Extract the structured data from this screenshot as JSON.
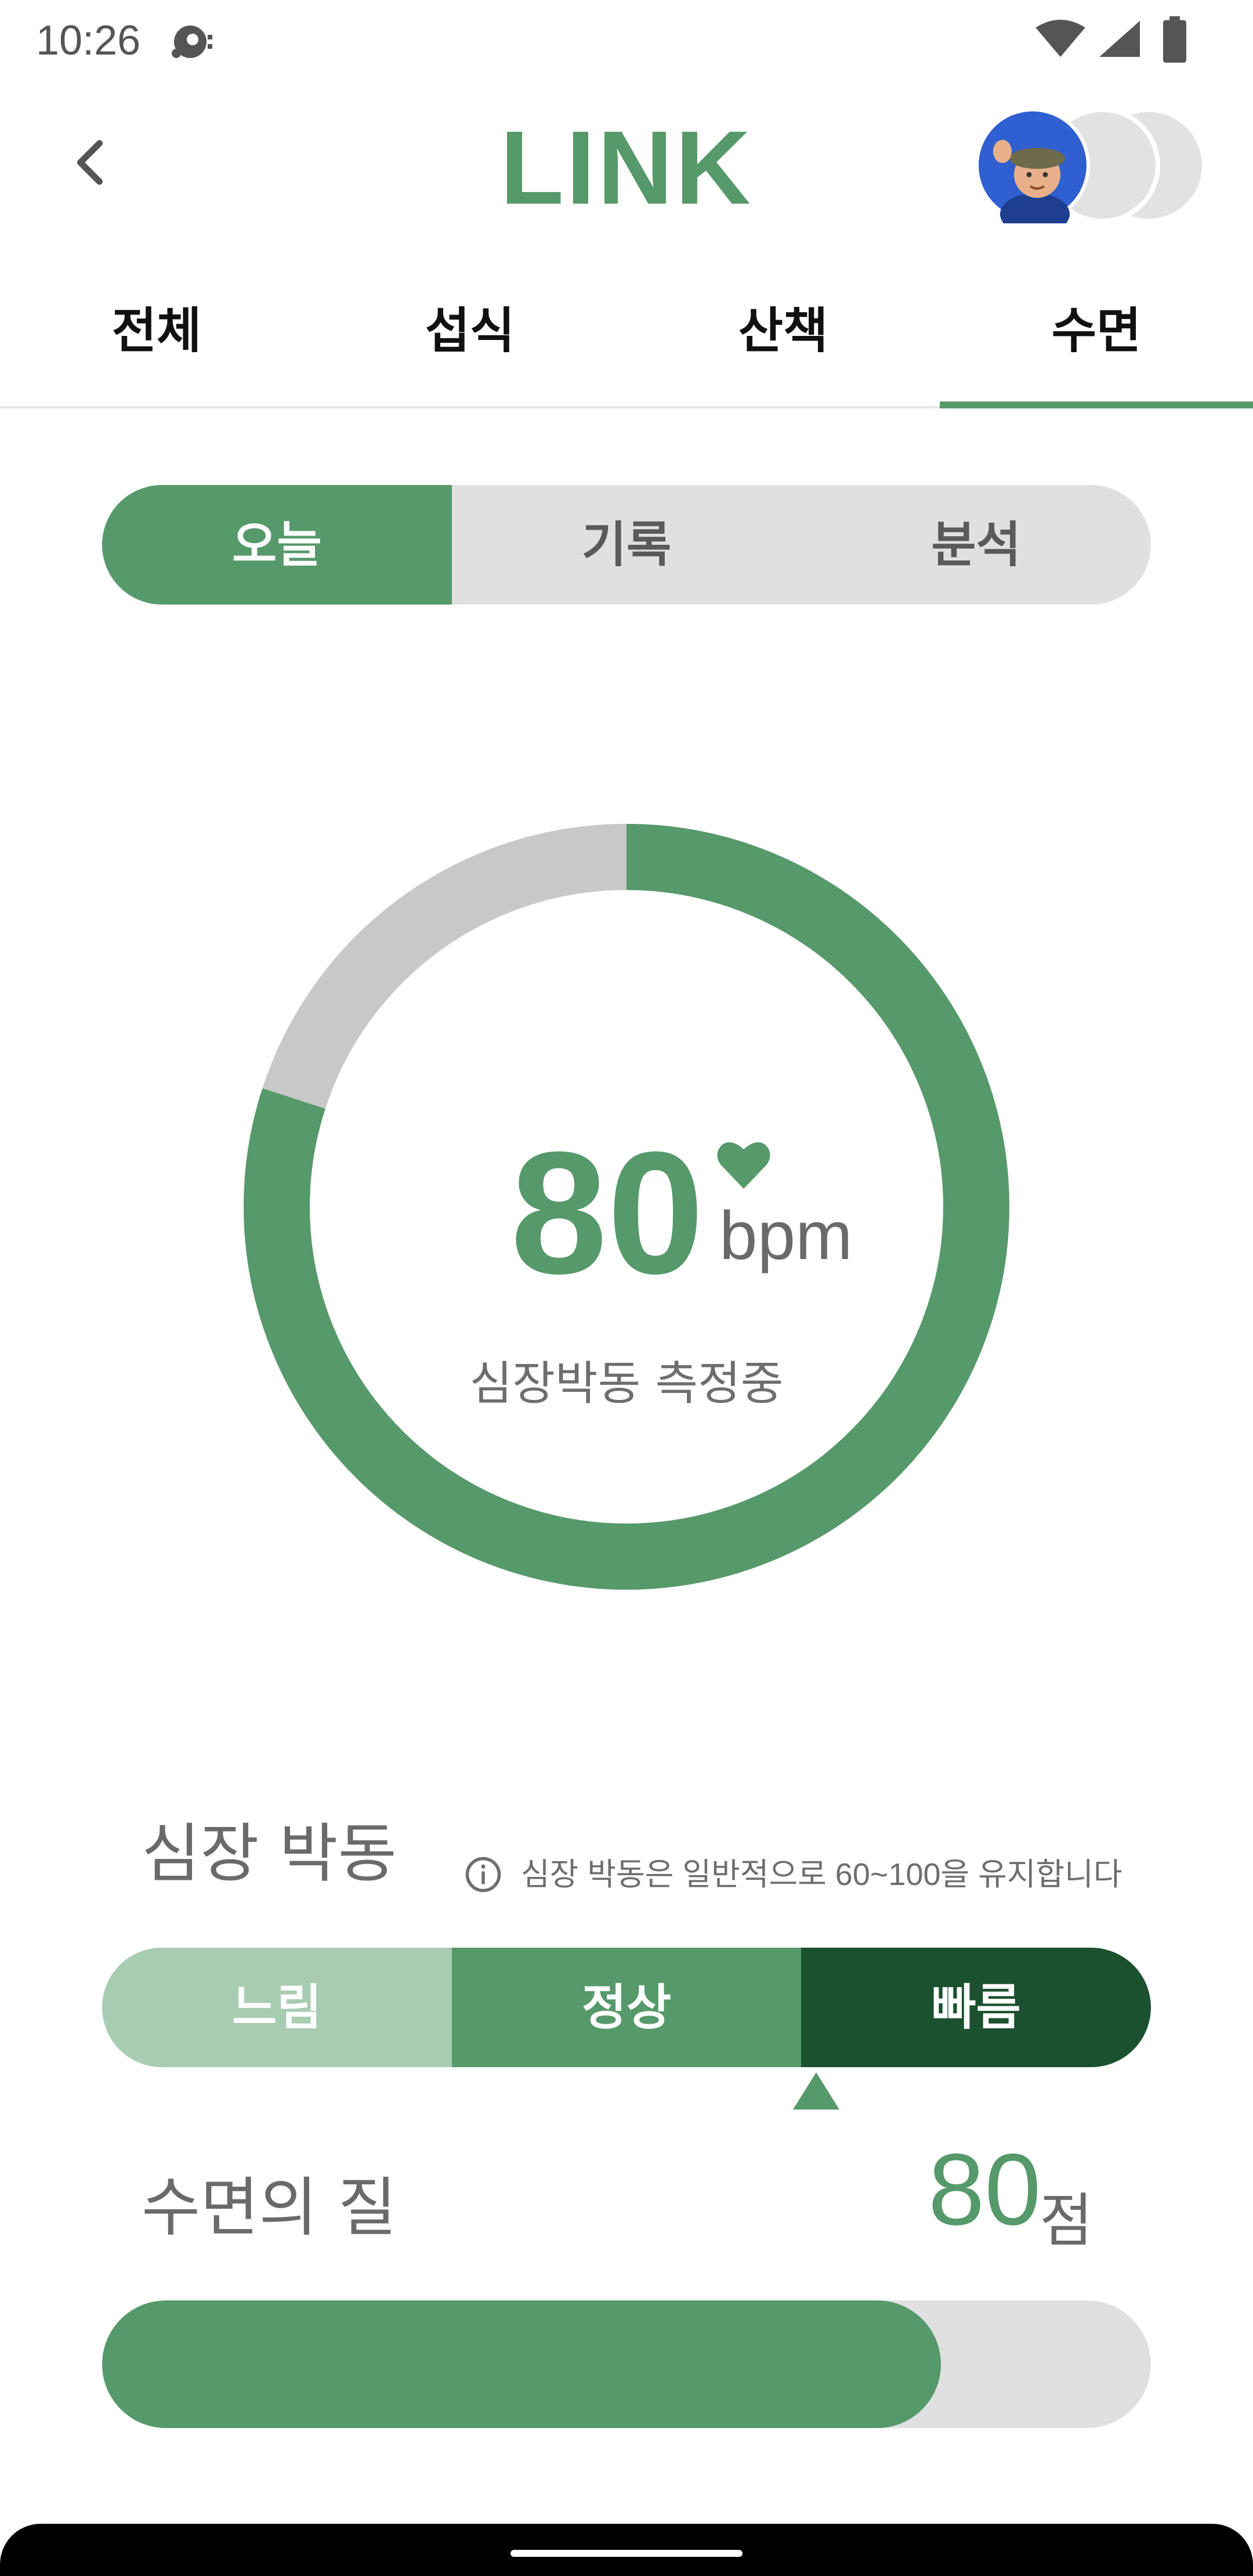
{
  "status_bar": {
    "time": "10:26",
    "app_icon": "media-icon",
    "icons": [
      "wifi-icon",
      "signal-icon",
      "battery-icon"
    ]
  },
  "header": {
    "back_icon": "chevron-left-icon",
    "logo": "LINK",
    "avatar": "memoji-avatar"
  },
  "tabs": {
    "items": [
      {
        "label": "전체"
      },
      {
        "label": "섭식"
      },
      {
        "label": "산책"
      },
      {
        "label": "수면"
      }
    ],
    "active_index": 3
  },
  "segmented": {
    "items": [
      {
        "label": "오늘"
      },
      {
        "label": "기록"
      },
      {
        "label": "분석"
      }
    ],
    "active_index": 0
  },
  "heart_ring": {
    "value": "80",
    "unit": "bpm",
    "status": "심장박동 측정중",
    "progress_fraction": 0.8,
    "icon": "heart-icon"
  },
  "heart_rate": {
    "title": "심장 박동",
    "info_icon": "info-icon",
    "info": "심장 박동은 일반적으로 60~100을 유지합니다",
    "levels": [
      {
        "label": "느림",
        "color": "#A8CCB1"
      },
      {
        "label": "정상",
        "color": "#56996A"
      },
      {
        "label": "빠름",
        "color": "#1C5130"
      }
    ],
    "marker_position_fraction": 0.68
  },
  "sleep_quality": {
    "title": "수면의 질",
    "score": "80",
    "unit": "점",
    "progress_fraction": 0.8
  },
  "colors": {
    "accent": "#56996A",
    "track": "#E0E0E0",
    "ring_rest": "#C8C8C8"
  }
}
